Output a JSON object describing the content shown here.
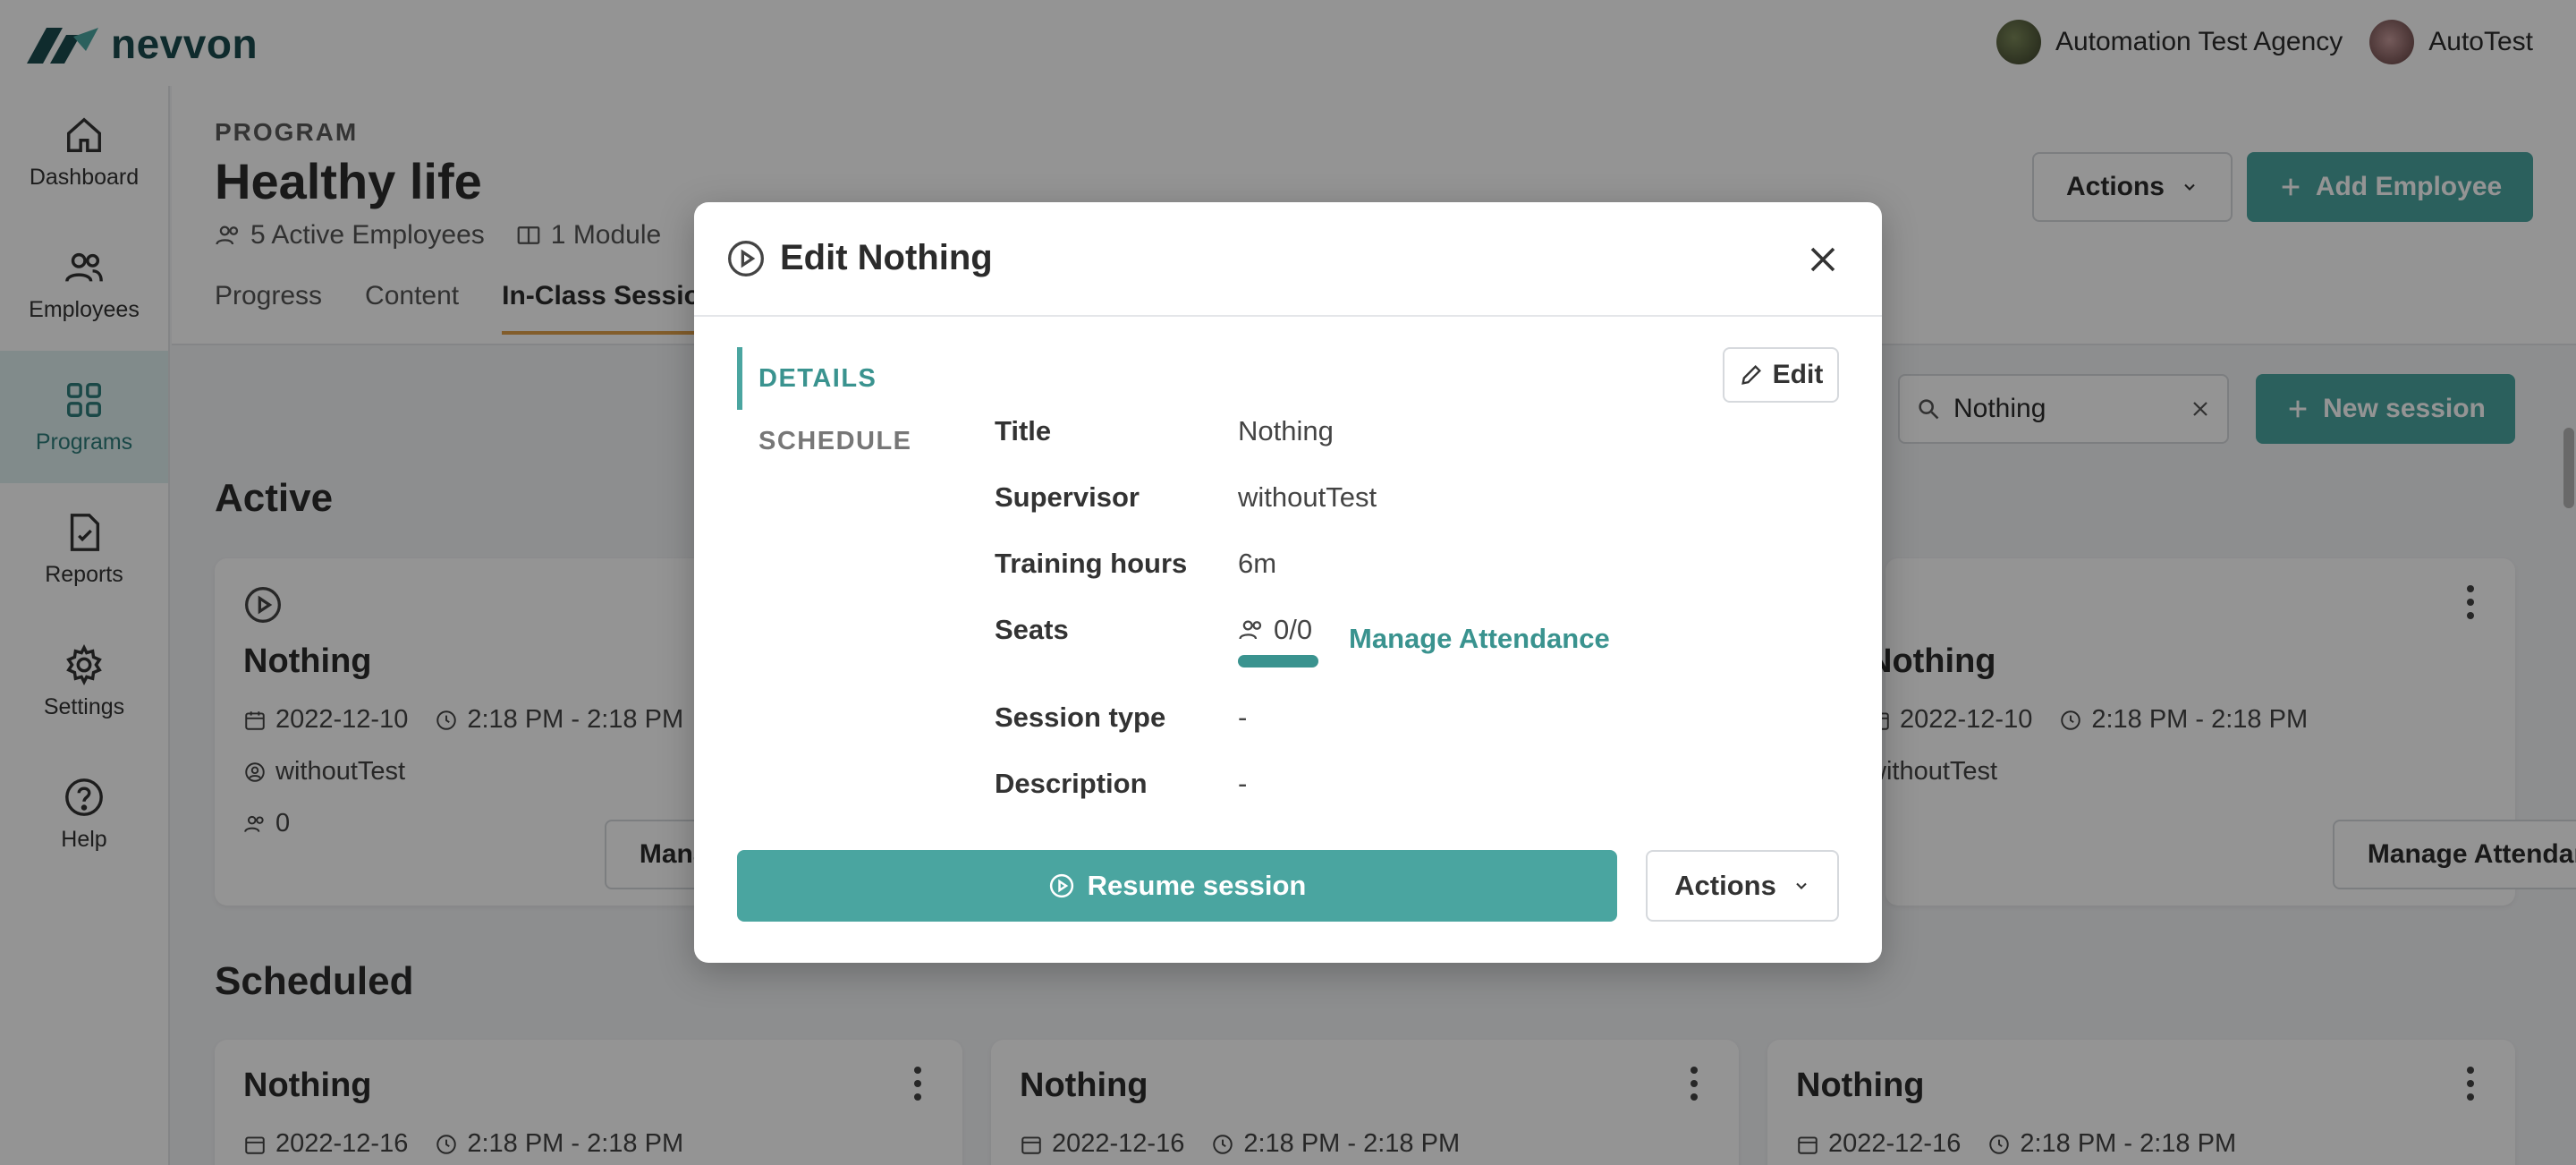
{
  "brand": {
    "name": "nevvon"
  },
  "topbar": {
    "agency": "Automation Test Agency",
    "user": "AutoTest"
  },
  "sidebar": {
    "items": [
      {
        "label": "Dashboard",
        "icon": "home-icon"
      },
      {
        "label": "Employees",
        "icon": "users-icon"
      },
      {
        "label": "Programs",
        "icon": "grid-icon",
        "active": true
      },
      {
        "label": "Reports",
        "icon": "report-icon"
      },
      {
        "label": "Settings",
        "icon": "gear-icon"
      },
      {
        "label": "Help",
        "icon": "help-icon"
      }
    ]
  },
  "program": {
    "eyebrow": "PROGRAM",
    "title": "Healthy life",
    "employees": "5 Active Employees",
    "modules": "1 Module",
    "tabs": [
      "Progress",
      "Content",
      "In-Class Sessions"
    ],
    "actions_label": "Actions",
    "add_employee_label": "Add Employee"
  },
  "sessions_toolbar": {
    "search_value": "Nothing",
    "new_session_label": "New session"
  },
  "sections": {
    "active": "Active",
    "scheduled": "Scheduled"
  },
  "active_cards": [
    {
      "title": "Nothing",
      "date": "2022-12-10",
      "time": "2:18 PM - 2:18 PM",
      "supervisor": "withoutTest",
      "seats": "0",
      "button": "Manage Attendance"
    },
    {
      "title": "Nothing",
      "date": "2022-12-10",
      "time": "2:18 PM - 2:18 PM",
      "supervisor": "withoutTest",
      "seats": "0",
      "button": "Manage Attendance"
    }
  ],
  "scheduled_cards": [
    {
      "title": "Nothing",
      "date": "2022-12-16",
      "time": "2:18 PM - 2:18 PM"
    },
    {
      "title": "Nothing",
      "date": "2022-12-16",
      "time": "2:18 PM - 2:18 PM"
    },
    {
      "title": "Nothing",
      "date": "2022-12-16",
      "time": "2:18 PM - 2:18 PM"
    }
  ],
  "modal": {
    "title": "Edit Nothing",
    "nav": [
      "DETAILS",
      "SCHEDULE"
    ],
    "edit_label": "Edit",
    "fields": {
      "title_k": "Title",
      "title_v": "Nothing",
      "supervisor_k": "Supervisor",
      "supervisor_v": "withoutTest",
      "hours_k": "Training hours",
      "hours_v": "6m",
      "seats_k": "Seats",
      "seats_v": "0/0",
      "type_k": "Session type",
      "type_v": "-",
      "desc_k": "Description",
      "desc_v": "-"
    },
    "manage_attendance": "Manage Attendance",
    "resume_label": "Resume session",
    "actions_label": "Actions"
  },
  "colors": {
    "accent": "#4aa5a0",
    "brand": "#1b4b4f",
    "tab_underline": "#e0a04a"
  }
}
